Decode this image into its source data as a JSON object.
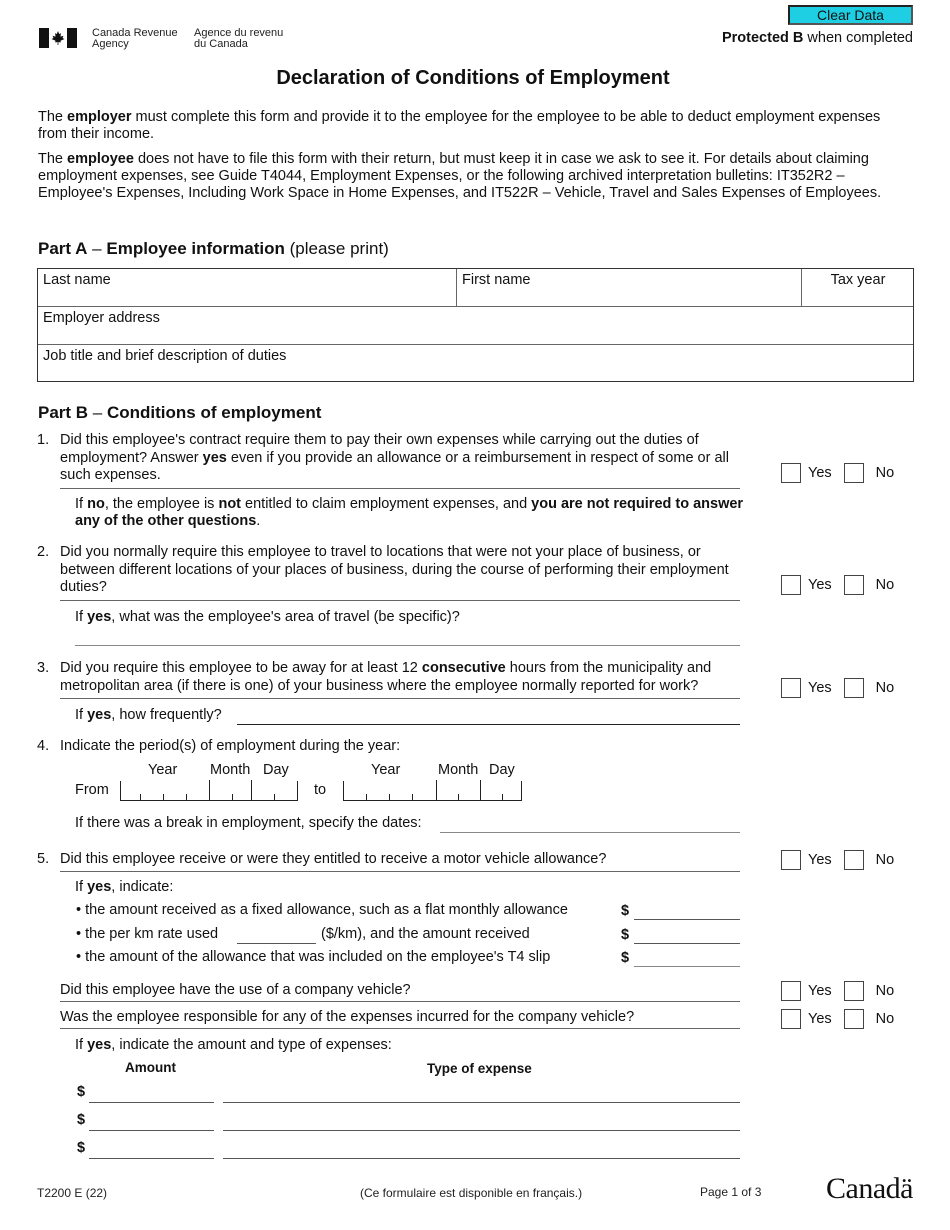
{
  "header": {
    "agency_en_line1": "Canada Revenue",
    "agency_en_line2": "Agency",
    "agency_fr_line1": "Agence du revenu",
    "agency_fr_line2": "du Canada",
    "clear_button": "Clear Data",
    "clear_button_color": "#1ecfe3",
    "protected_bold": "Protected B",
    "protected_rest": " when completed",
    "title": "Declaration of Conditions of Employment"
  },
  "intro": {
    "p1_a": "The ",
    "p1_bold": "employer",
    "p1_b": " must complete this form and provide it to the employee for the employee to be able to deduct employment expenses from their income.",
    "p2_a": "The ",
    "p2_bold": "employee",
    "p2_b": " does not have to file this form with their return, but must keep it in case we ask to see it. For details about claiming employment expenses, see Guide T4044, Employment Expenses, or the following archived interpretation bulletins: IT352R2 – Employee's Expenses, Including Work Space in Home Expenses, and IT522R – Vehicle, Travel and Sales Expenses of Employees."
  },
  "part_a": {
    "heading_part": "Part A",
    "heading_dash": " – ",
    "heading_bold": "Employee information",
    "heading_rest": " (please print)",
    "fields": {
      "last_name": {
        "label": "Last name",
        "value": ""
      },
      "first_name": {
        "label": "First name",
        "value": ""
      },
      "tax_year": {
        "label": "Tax year",
        "value": ""
      },
      "employer_address": {
        "label": "Employer address",
        "value": ""
      },
      "job_title": {
        "label": "Job title and brief description of duties",
        "value": ""
      }
    }
  },
  "part_b": {
    "heading_part": "Part B",
    "heading_dash": " – ",
    "heading_bold": "Conditions of employment",
    "yes": "Yes",
    "no": "No",
    "q1": {
      "num": "1.",
      "a": "Did this employee's contract require them to pay their own expenses while carrying out the duties of employment? Answer ",
      "bold": "yes",
      "b": " even if you provide an allowance or a reimbursement in respect of some or all such expenses.",
      "note_a": "If ",
      "note_b1": "no",
      "note_c": ", the employee is ",
      "note_b2": "not",
      "note_d": " entitled to claim employment expenses, and ",
      "note_b3": "you are not required to answer any of the other questions",
      "note_e": "."
    },
    "q2": {
      "num": "2.",
      "text": "Did you normally require this employee to travel to locations that were not your place of business, or between different locations of your places of business, during the course of performing their employment duties?",
      "follow_a": "If ",
      "follow_bold": "yes",
      "follow_b": ", what was the employee's area of travel (be specific)?",
      "follow_value": ""
    },
    "q3": {
      "num": "3.",
      "a": "Did you require this employee to be away for at least 12 ",
      "bold": "consecutive",
      "b": " hours from the municipality and metropolitan area (if there is one) of your business where the employee normally reported for work?",
      "follow_a": "If ",
      "follow_bold": "yes",
      "follow_b": ", how frequently?",
      "follow_value": ""
    },
    "q4": {
      "num": "4.",
      "text": "Indicate the period(s) of employment during the year:",
      "year": "Year",
      "month": "Month",
      "day": "Day",
      "from": "From",
      "to": "to",
      "break_text": "If there was a break in employment, specify the dates:",
      "break_value": ""
    },
    "q5": {
      "num": "5.",
      "text": "Did this employee receive or were they entitled to receive a motor vehicle allowance?",
      "follow_a": "If ",
      "follow_bold": "yes",
      "follow_b": ", indicate:",
      "bullet1": "the amount received as a fixed allowance, such as a flat monthly allowance",
      "bullet2_a": "the per km rate used",
      "bullet2_b": "($/km), and the amount received",
      "bullet3": "the amount of the allowance that was included on the employee's T4 slip",
      "dollar": "$",
      "company_vehicle": "Did this employee have the use of a company vehicle?",
      "responsible": "Was the employee responsible for any of the expenses incurred for the company vehicle?",
      "expenses_a": "If ",
      "expenses_bold": "yes",
      "expenses_b": ", indicate the amount and type of expenses:",
      "amount_header": "Amount",
      "type_header": "Type of expense",
      "expense_rows": [
        {
          "amount": "",
          "type": ""
        },
        {
          "amount": "",
          "type": ""
        },
        {
          "amount": "",
          "type": ""
        }
      ]
    }
  },
  "footer": {
    "form_code": "T2200 E (22)",
    "french_note": "(Ce formulaire est disponible en français.)",
    "page": "Page 1 of 3",
    "wordmark": "Canadä"
  }
}
